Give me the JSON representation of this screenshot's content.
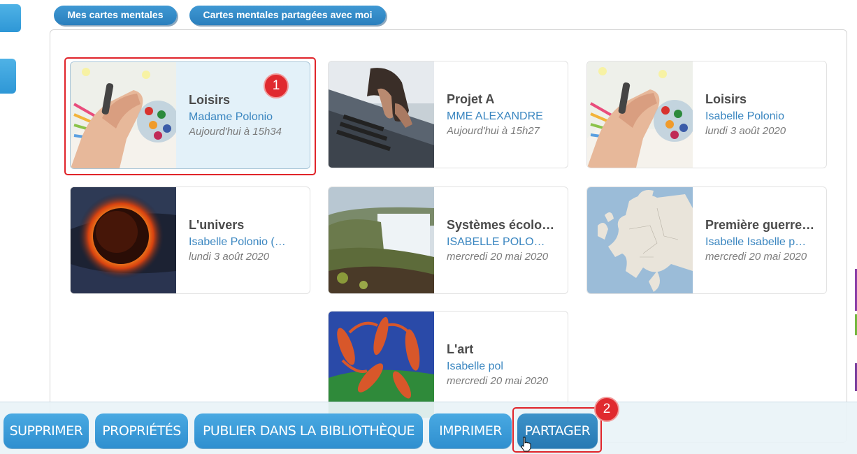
{
  "tabs": {
    "my_maps": "Mes cartes mentales",
    "shared_maps": "Cartes mentales partagées avec moi"
  },
  "cards": [
    {
      "title": "Loisirs",
      "author": "Madame Polonio",
      "date": "Aujourd'hui à 15h34",
      "image": "child-drawing-with-crayons",
      "selected": true
    },
    {
      "title": "Projet A",
      "author": "MME ALEXANDRE",
      "date": "Aujourd'hui à 15h27",
      "image": "hands-typing-on-laptop"
    },
    {
      "title": "Loisirs",
      "author": "Isabelle Polonio",
      "date": "lundi 3 août 2020",
      "image": "child-drawing-with-crayons"
    },
    {
      "title": "L'univers",
      "author": "Isabelle Polonio (…",
      "date": "lundi 3 août 2020",
      "image": "solar-eclipse"
    },
    {
      "title": "Systèmes écolo…",
      "author": "ISABELLE POLO…",
      "date": "mercredi 20 mai 2020",
      "image": "waterfall-landscape"
    },
    {
      "title": "Première guerre …",
      "author": "Isabelle Isabelle p…",
      "date": "mercredi 20 mai 2020",
      "image": "map-of-europe"
    },
    {
      "title": "L'art",
      "author": "Isabelle pol",
      "date": "mercredi 20 mai 2020",
      "image": "matisse-dance-painting"
    }
  ],
  "badges": {
    "first": "1",
    "second": "2"
  },
  "footer": {
    "delete": "SUPPRIMER",
    "properties": "PROPRIÉTÉS",
    "publish": "PUBLIER DANS LA BIBLIOTHÈQUE",
    "print": "IMPRIMER",
    "share": "PARTAGER"
  },
  "colors": {
    "button_blue": "#2f8fcf",
    "highlight_red": "#e0242a",
    "author_blue": "#3a86c0",
    "selected_card": "#e3f1f9"
  }
}
